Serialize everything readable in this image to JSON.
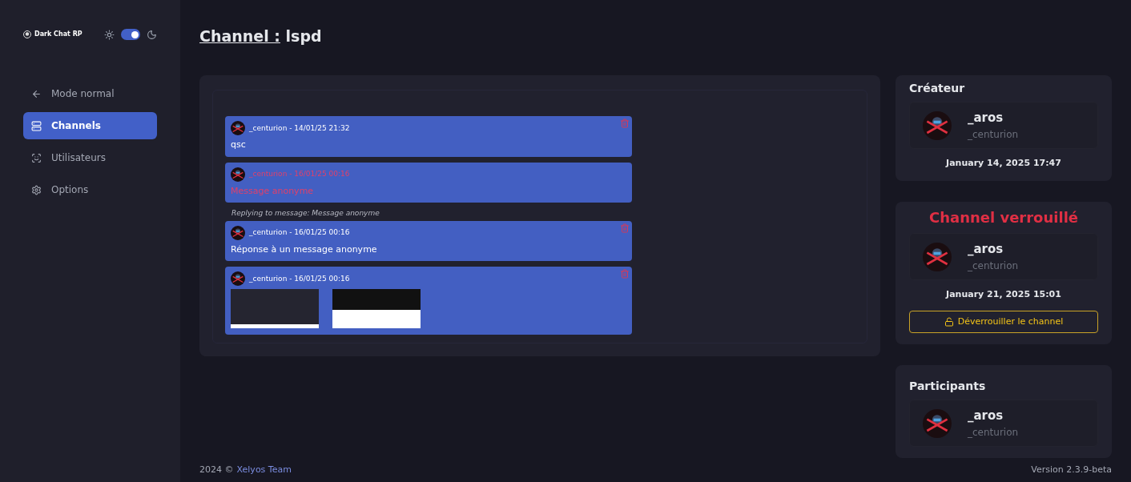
{
  "sidebar": {
    "logo": "Dark Chat RP",
    "dark_mode": true,
    "items": [
      {
        "kind": "back",
        "label": "Mode normal",
        "selected": false
      },
      {
        "kind": "channels",
        "label": "Channels",
        "selected": true
      },
      {
        "kind": "users",
        "label": "Utilisateurs",
        "selected": false
      },
      {
        "kind": "options",
        "label": "Options",
        "selected": false
      }
    ]
  },
  "header": {
    "prefix": "Channel :",
    "channel": "lspd"
  },
  "messages": [
    {
      "header": "_centurion - 14/01/25 21:32",
      "text": "qsc",
      "anonymous": false,
      "deletable": true
    },
    {
      "header": "_centurion - 16/01/25 00:16",
      "text": "Message anonyme",
      "anonymous": true,
      "deletable": false
    },
    {
      "reply_to": "Replying to message: Message anonyme",
      "header": "_centurion - 16/01/25 00:16",
      "text": "Réponse à un message anonyme",
      "anonymous": false,
      "deletable": true
    },
    {
      "header": "_centurion - 16/01/25 00:16",
      "anonymous": false,
      "deletable": true,
      "attachments": [
        {
          "kind": "dark"
        },
        {
          "kind": "light"
        }
      ]
    }
  ],
  "creator": {
    "title": "Créateur",
    "name": "_aros",
    "username": "_centurion",
    "date": "January 14, 2025 17:47"
  },
  "lock": {
    "title": "Channel verrouillé",
    "locked": true,
    "name": "_aros",
    "username": "_centurion",
    "date": "January 21, 2025 15:01",
    "button": "Déverrouiller le channel"
  },
  "participants": {
    "title": "Participants",
    "items": [
      {
        "name": "_aros",
        "username": "_centurion"
      }
    ]
  },
  "footer": {
    "copyright": "2024 ©",
    "link": "Xelyos Team",
    "version": "Version 2.3.9-beta"
  }
}
